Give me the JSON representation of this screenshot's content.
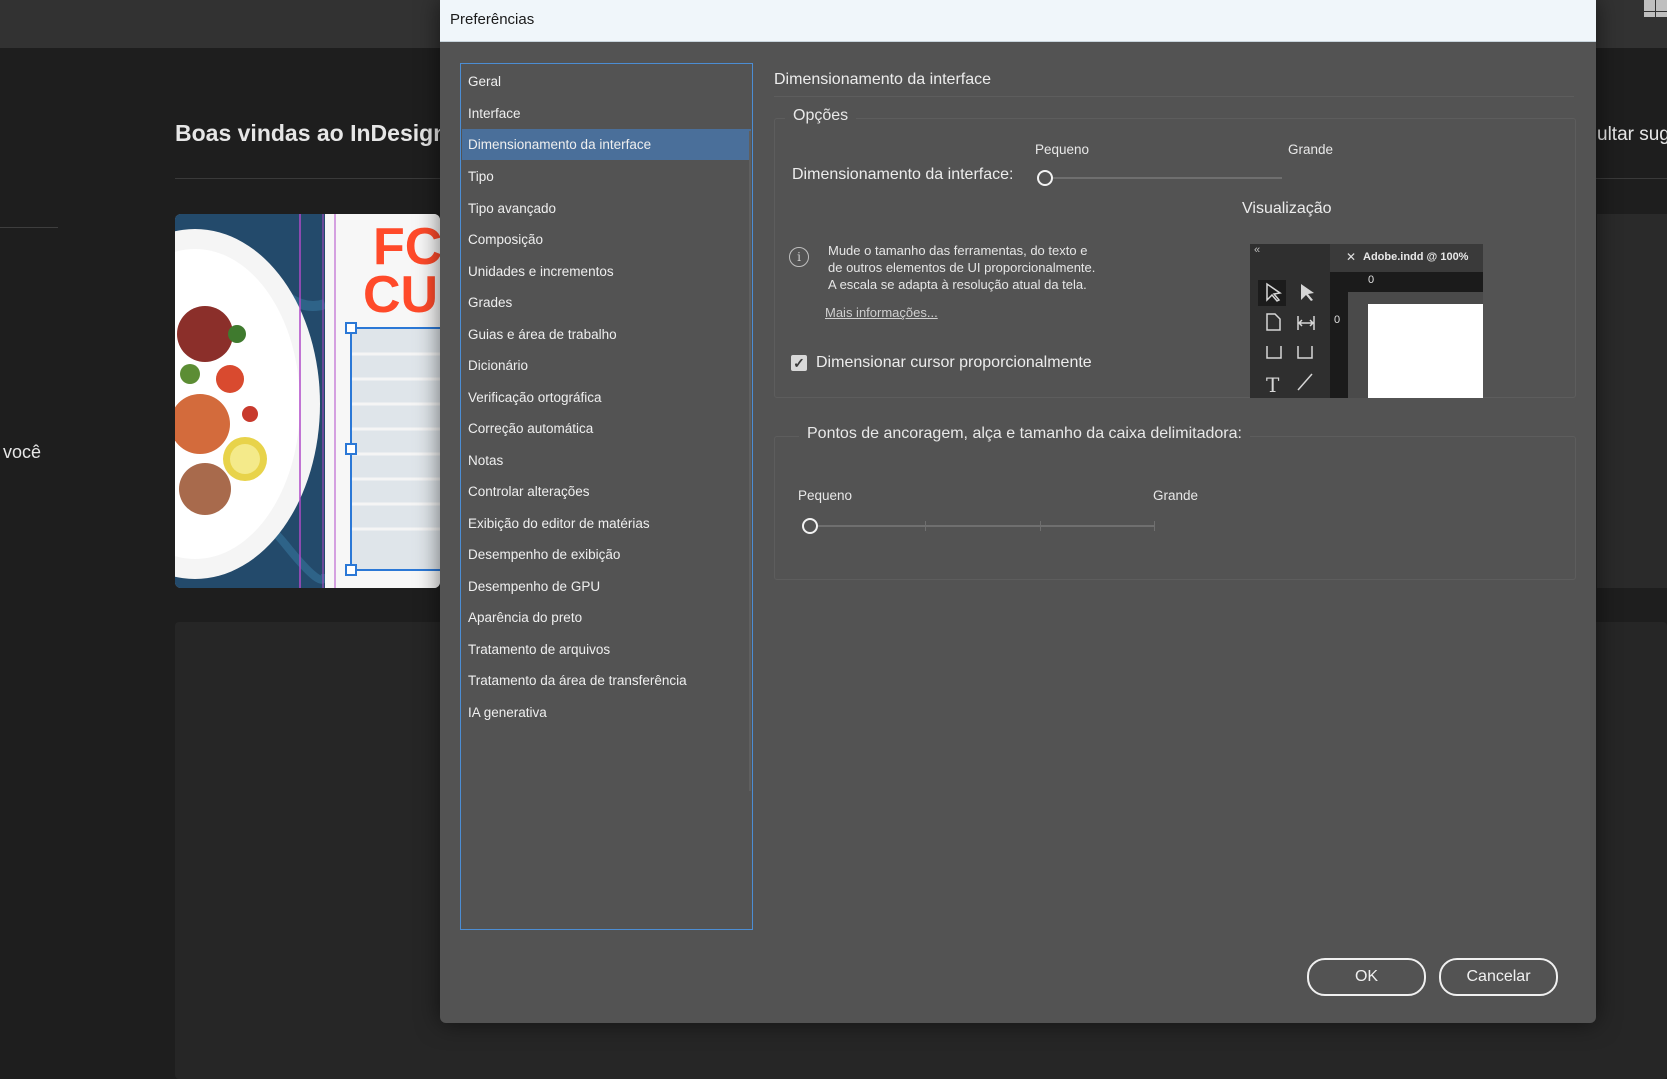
{
  "background": {
    "welcome_text": "Boas vindas ao InDesign, V",
    "right_text": "ultar suge",
    "left_text": "você",
    "card_heading_1": "FC",
    "card_heading_2": "CU"
  },
  "dialog": {
    "title": "Preferências",
    "categories": [
      {
        "label": "Geral"
      },
      {
        "label": "Interface"
      },
      {
        "label": "Dimensionamento da interface"
      },
      {
        "label": "Tipo"
      },
      {
        "label": "Tipo avançado"
      },
      {
        "label": "Composição"
      },
      {
        "label": "Unidades e incrementos"
      },
      {
        "label": "Grades"
      },
      {
        "label": "Guias e área de trabalho"
      },
      {
        "label": "Dicionário"
      },
      {
        "label": "Verificação ortográfica"
      },
      {
        "label": "Correção automática"
      },
      {
        "label": "Notas"
      },
      {
        "label": "Controlar alterações"
      },
      {
        "label": "Exibição do editor de matérias"
      },
      {
        "label": "Desempenho de exibição"
      },
      {
        "label": "Desempenho de GPU"
      },
      {
        "label": "Aparência do preto"
      },
      {
        "label": "Tratamento de arquivos"
      },
      {
        "label": "Tratamento da área de transferência"
      },
      {
        "label": "IA generativa"
      }
    ],
    "selected_category": "Dimensionamento da interface",
    "section_title": "Dimensionamento da interface",
    "options": {
      "group_title": "Opções",
      "slider_label": "Dimensionamento da interface:",
      "min_label": "Pequeno",
      "max_label": "Grande",
      "slider_value": 0,
      "preview_label": "Visualização",
      "info_line_1": "Mude o tamanho das ferramentas, do texto e",
      "info_line_2": "de outros elementos de UI proporcionalmente.",
      "info_line_3": "A escala se adapta à resolução atual da tela.",
      "more_info_link": "Mais informações...",
      "checkbox_label": "Dimensionar cursor proporcionalmente",
      "checkbox_checked": true,
      "preview_tab": "Adobe.indd @ 100%",
      "preview_ruler_h": "0",
      "preview_ruler_v": "0",
      "preview_collapse": "«"
    },
    "anchor": {
      "group_title": "Pontos de ancoragem, alça e tamanho da caixa delimitadora:",
      "min_label": "Pequeno",
      "max_label": "Grande",
      "slider_value": 0
    },
    "buttons": {
      "ok": "OK",
      "cancel": "Cancelar"
    }
  }
}
